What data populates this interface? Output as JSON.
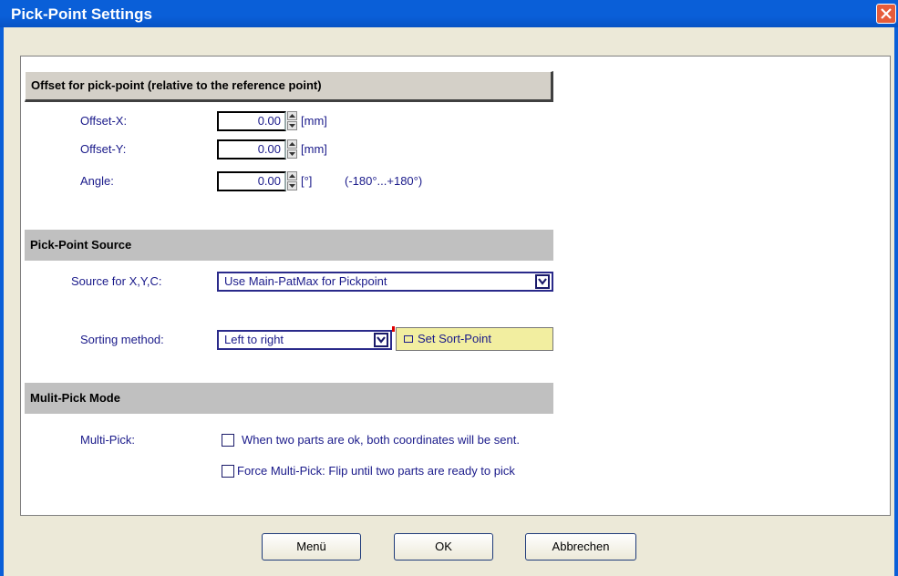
{
  "window": {
    "title": "Pick-Point Settings",
    "close_icon": "close-icon"
  },
  "offset_section": {
    "header": "Offset for pick-point (relative to the reference point)",
    "offset_x": {
      "label": "Offset-X:",
      "value": "0.00",
      "unit": "[mm]"
    },
    "offset_y": {
      "label": "Offset-Y:",
      "value": "0.00",
      "unit": "[mm]"
    },
    "angle": {
      "label": "Angle:",
      "value": "0.00",
      "unit": "[°]",
      "range": "(-180°...+180°)"
    }
  },
  "source_section": {
    "header": "Pick-Point Source",
    "source_label": "Source for X,Y,C:",
    "source_value": "Use Main-PatMax for Pickpoint",
    "sorting_label": "Sorting method:",
    "sorting_value": "Left to right",
    "sort_point_button": "Set Sort-Point"
  },
  "multipick_section": {
    "header": "Mulit-Pick Mode",
    "label": "Multi-Pick:",
    "option1": "When two parts are ok, both coordinates will be sent.",
    "option2": "Force Multi-Pick:  Flip until two parts are ready to pick",
    "option1_checked": false,
    "option2_checked": false
  },
  "buttons": {
    "menu": "Menü",
    "ok": "OK",
    "cancel": "Abbrechen"
  },
  "colors": {
    "titlebar": "#0a5fd8",
    "label_text": "#1a1a8a",
    "sort_button_bg": "#f2eea0"
  }
}
